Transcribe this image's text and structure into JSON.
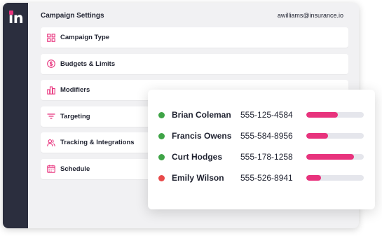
{
  "app": {
    "logo_text": "in",
    "page_title": "Campaign Settings",
    "user_email": "awilliams@insurance.io",
    "accent_color": "#e8337d"
  },
  "menu": {
    "items": [
      {
        "label": "Campaign Type",
        "icon": "grid-icon"
      },
      {
        "label": "Budgets & Limits",
        "icon": "dollar-icon"
      },
      {
        "label": "Modifiers",
        "icon": "bar-chart-icon"
      },
      {
        "label": "Targeting",
        "icon": "filter-icon"
      },
      {
        "label": "Tracking & Integrations",
        "icon": "users-icon"
      },
      {
        "label": "Schedule",
        "icon": "calendar-icon"
      }
    ]
  },
  "contacts": [
    {
      "name": "Brian Coleman",
      "phone": "555-125-4584",
      "status_color": "#3fa447",
      "progress": 0.55
    },
    {
      "name": "Francis Owens",
      "phone": "555-584-8956",
      "status_color": "#3fa447",
      "progress": 0.38
    },
    {
      "name": "Curt Hodges",
      "phone": "555-178-1258",
      "status_color": "#3fa447",
      "progress": 0.83
    },
    {
      "name": "Emily Wilson",
      "phone": "555-526-8941",
      "status_color": "#e84a4a",
      "progress": 0.25
    }
  ]
}
